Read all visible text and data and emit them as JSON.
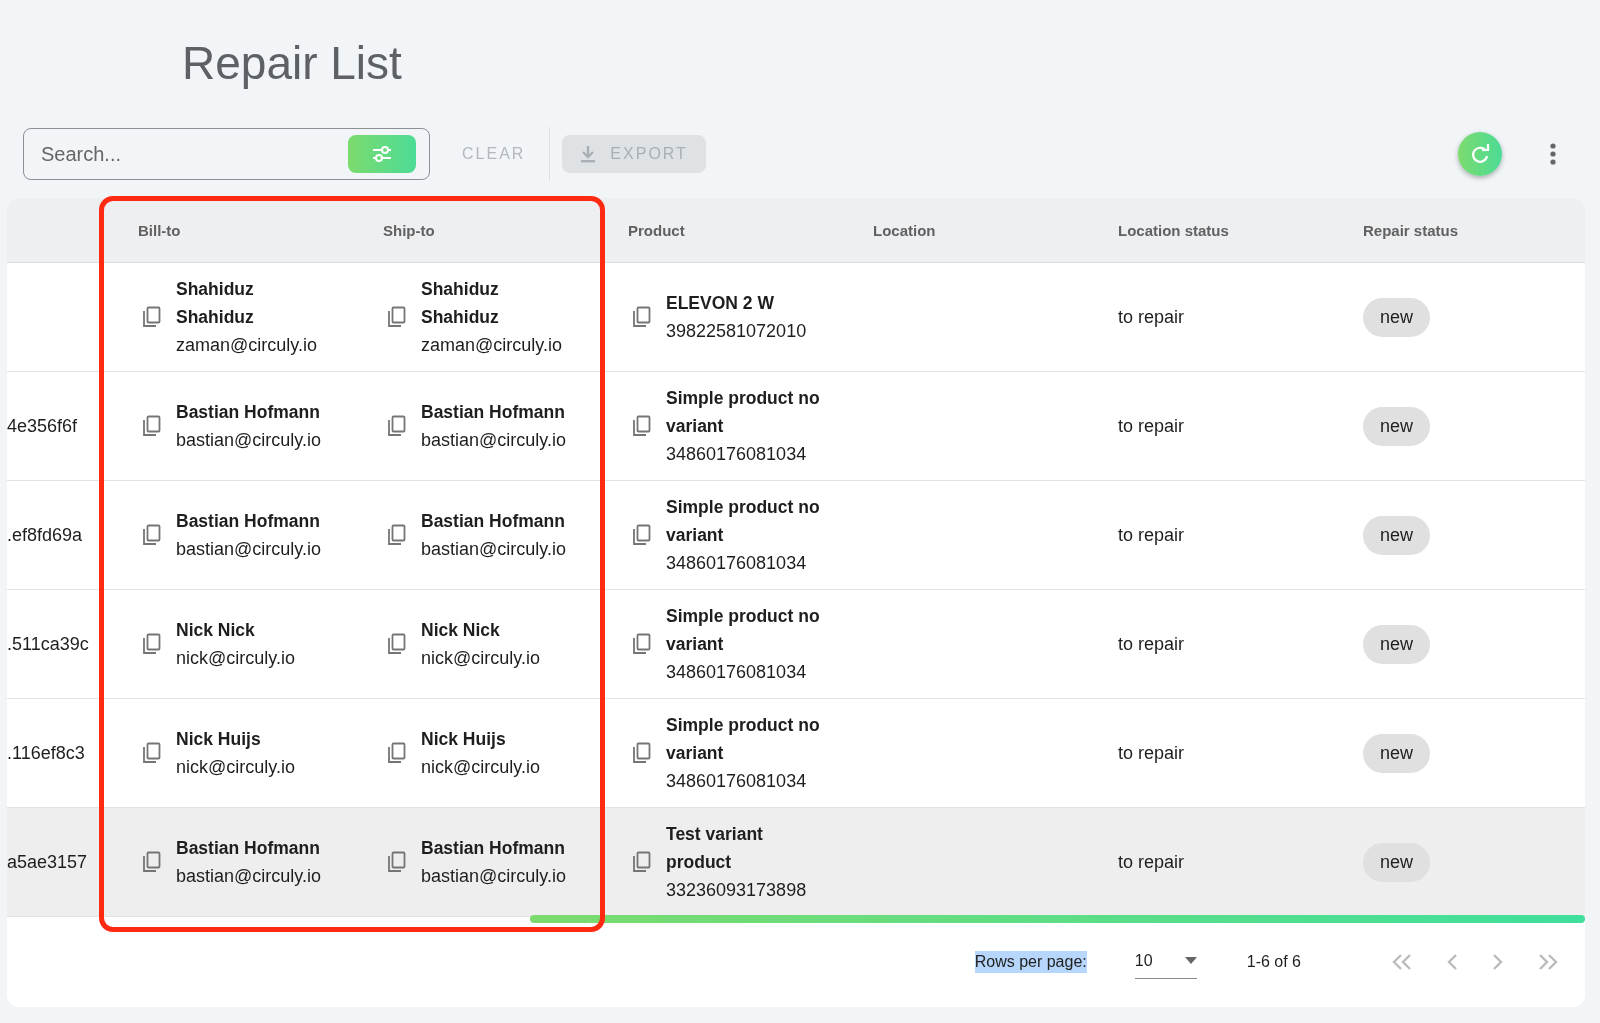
{
  "page_title": "Repair List",
  "toolbar": {
    "search": {
      "placeholder": "Search..."
    },
    "clear_label": "CLEAR",
    "export_label": "EXPORT"
  },
  "table": {
    "columns": [
      "",
      "Bill-to",
      "Ship-to",
      "Product",
      "Location",
      "Location status",
      "Repair status"
    ],
    "rows": [
      {
        "id": "",
        "bill_to": {
          "name": "Shahiduz Shahiduz",
          "email": "zaman@circuly.io"
        },
        "ship_to": {
          "name": "Shahiduz Shahiduz",
          "email": "zaman@circuly.io"
        },
        "product": {
          "name": "ELEVON 2 W",
          "sku": "39822581072010"
        },
        "location_status": "to repair",
        "repair_status": "new",
        "highlighted": false
      },
      {
        "id": "4e356f6f",
        "bill_to": {
          "name": "Bastian Hofmann",
          "email": "bastian@circuly.io"
        },
        "ship_to": {
          "name": "Bastian Hofmann",
          "email": "bastian@circuly.io"
        },
        "product": {
          "name": "Simple product no variant",
          "sku": "34860176081034"
        },
        "location_status": "to repair",
        "repair_status": "new",
        "highlighted": false
      },
      {
        "id": ".ef8fd69a",
        "bill_to": {
          "name": "Bastian Hofmann",
          "email": "bastian@circuly.io"
        },
        "ship_to": {
          "name": "Bastian Hofmann",
          "email": "bastian@circuly.io"
        },
        "product": {
          "name": "Simple product no variant",
          "sku": "34860176081034"
        },
        "location_status": "to repair",
        "repair_status": "new",
        "highlighted": false
      },
      {
        "id": ".511ca39c",
        "bill_to": {
          "name": "Nick Nick",
          "email": "nick@circuly.io"
        },
        "ship_to": {
          "name": "Nick Nick",
          "email": "nick@circuly.io"
        },
        "product": {
          "name": "Simple product no variant",
          "sku": "34860176081034"
        },
        "location_status": "to repair",
        "repair_status": "new",
        "highlighted": false
      },
      {
        "id": ".116ef8c3",
        "bill_to": {
          "name": "Nick Huijs",
          "email": "nick@circuly.io"
        },
        "ship_to": {
          "name": "Nick Huijs",
          "email": "nick@circuly.io"
        },
        "product": {
          "name": "Simple product no variant",
          "sku": "34860176081034"
        },
        "location_status": "to repair",
        "repair_status": "new",
        "highlighted": false
      },
      {
        "id": "a5ae3157",
        "bill_to": {
          "name": "Bastian Hofmann",
          "email": "bastian@circuly.io"
        },
        "ship_to": {
          "name": "Bastian Hofmann",
          "email": "bastian@circuly.io"
        },
        "product": {
          "name": "Test variant product",
          "sku": "33236093173898"
        },
        "location_status": "to repair",
        "repair_status": "new",
        "highlighted": true
      }
    ]
  },
  "pagination": {
    "rows_per_page_label": "Rows per page:",
    "rows_per_page_label_highlighted": true,
    "rows_per_page": "10",
    "range": "1-6 of 6"
  }
}
